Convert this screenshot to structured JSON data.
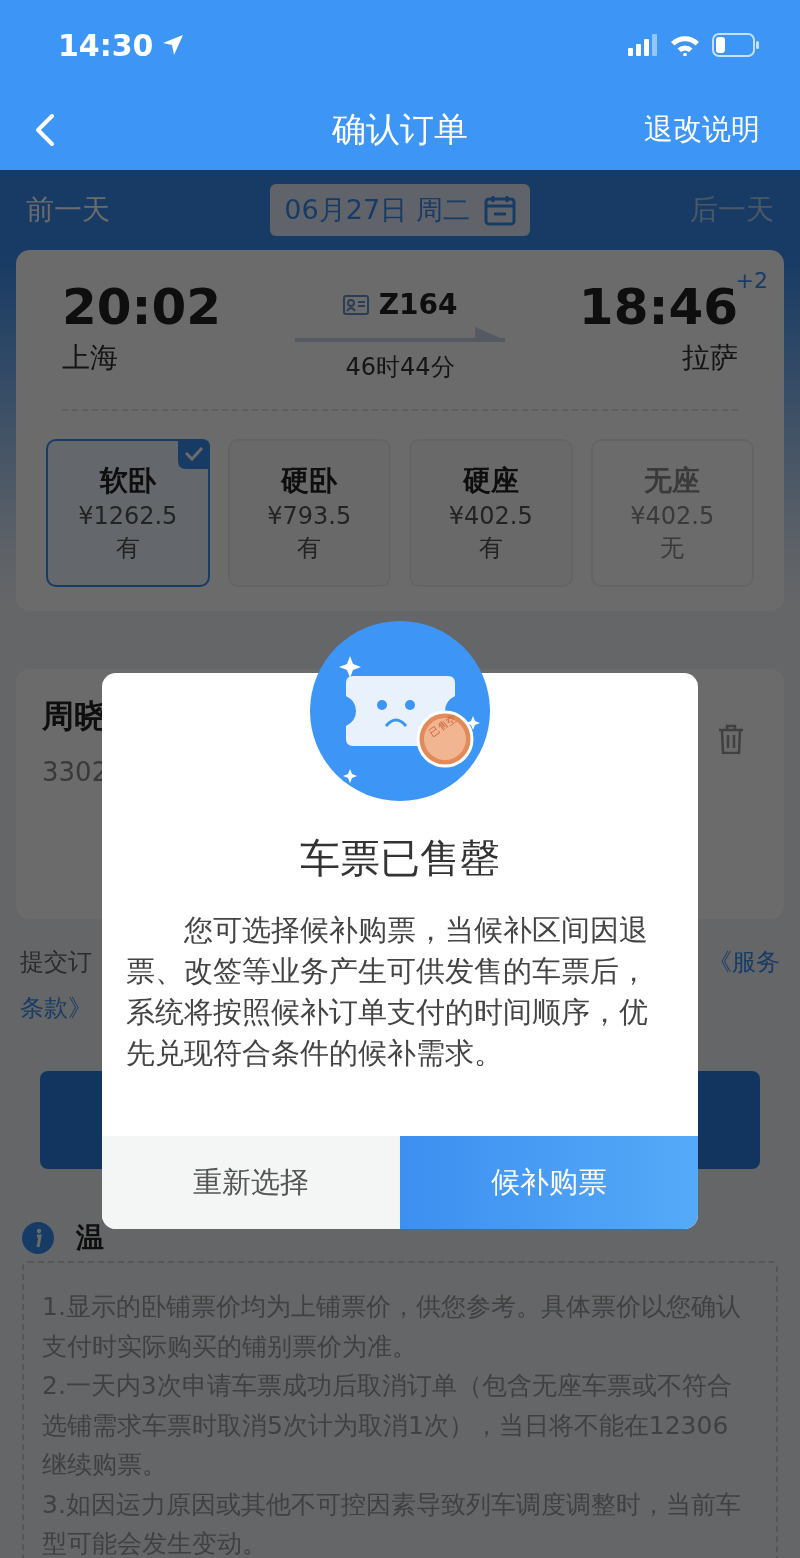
{
  "status_bar": {
    "time": "14:30"
  },
  "nav": {
    "title": "确认订单",
    "action": "退改说明"
  },
  "date_bar": {
    "prev": {
      "label": "前一天",
      "disabled": false
    },
    "date": "06月27日 周二",
    "next": {
      "label": "后一天",
      "disabled": true
    }
  },
  "train": {
    "depart_time": "20:02",
    "depart_station": "上海",
    "number": "Z164",
    "duration": "46时44分",
    "arrive_time": "18:46",
    "day_offset": "+2",
    "arrive_station": "拉萨"
  },
  "seats": [
    {
      "name": "软卧",
      "price": "¥1262.5",
      "availability": "有",
      "selected": true,
      "disabled": false
    },
    {
      "name": "硬卧",
      "price": "¥793.5",
      "availability": "有",
      "selected": false,
      "disabled": false
    },
    {
      "name": "硬座",
      "price": "¥402.5",
      "availability": "有",
      "selected": false,
      "disabled": false
    },
    {
      "name": "无座",
      "price": "¥402.5",
      "availability": "无",
      "selected": false,
      "disabled": true
    }
  ],
  "passenger": {
    "name": "周晓",
    "id_number": "3302"
  },
  "agreement": {
    "text": "提交订",
    "link_line1": "《服务",
    "link_line2": "条款》"
  },
  "notice": {
    "title": "温",
    "items": [
      "1.显示的卧铺票价均为上铺票价，供您参考。具体票价以您确认支付时实际购买的铺别票价为准。",
      "2.一天内3次申请车票成功后取消订单（包含无座车票或不符合选铺需求车票时取消5次计为取消1次），当日将不能在12306继续购票。",
      "3.如因运力原因或其他不可控因素导致列车调度调整时，当前车型可能会发生变动。"
    ]
  },
  "dialog": {
    "stamp": "已售空",
    "title": "车票已售罄",
    "message": "您可选择候补购票，当候补区间因退票、改签等业务产生可供发售的车票后，系统将按照候补订单支付的时间顺序，优先兑现符合条件的候补需求。",
    "buttons": [
      {
        "label": "重新选择",
        "kind": "secondary"
      },
      {
        "label": "候补购票",
        "kind": "primary"
      }
    ]
  }
}
